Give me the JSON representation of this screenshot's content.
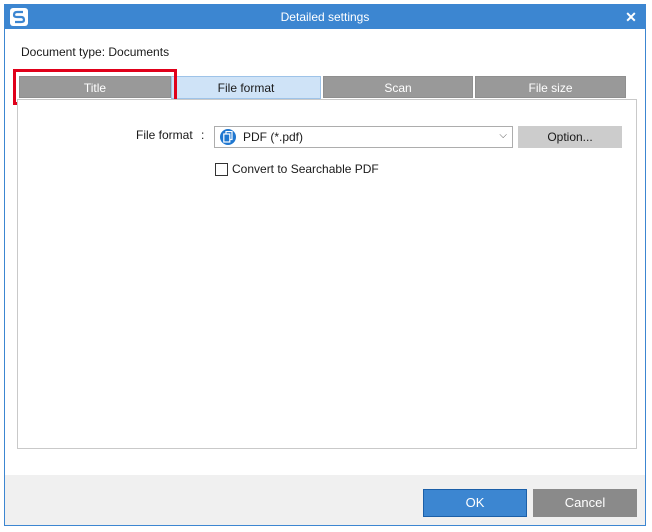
{
  "window": {
    "title": "Detailed settings",
    "close_glyph": "✕"
  },
  "document_type": "Document type: Documents",
  "tabs": [
    {
      "label": "Title",
      "state": "inactive",
      "highlighted": true
    },
    {
      "label": "File format",
      "state": "active"
    },
    {
      "label": "Scan",
      "state": "inactive"
    },
    {
      "label": "File size",
      "state": "inactive"
    }
  ],
  "file_format": {
    "label": "File format",
    "colon": ":",
    "selected": "PDF (*.pdf)",
    "option_button": "Option...",
    "icon": "pdf-icon"
  },
  "searchable_pdf": {
    "label": "Convert to Searchable PDF",
    "checked": false
  },
  "footer": {
    "ok_label": "OK",
    "cancel_label": "Cancel"
  },
  "colors": {
    "accent": "#3c86d1",
    "highlight": "#e0001a",
    "tab_inactive": "#999999",
    "tab_active": "#cfe3f7"
  }
}
